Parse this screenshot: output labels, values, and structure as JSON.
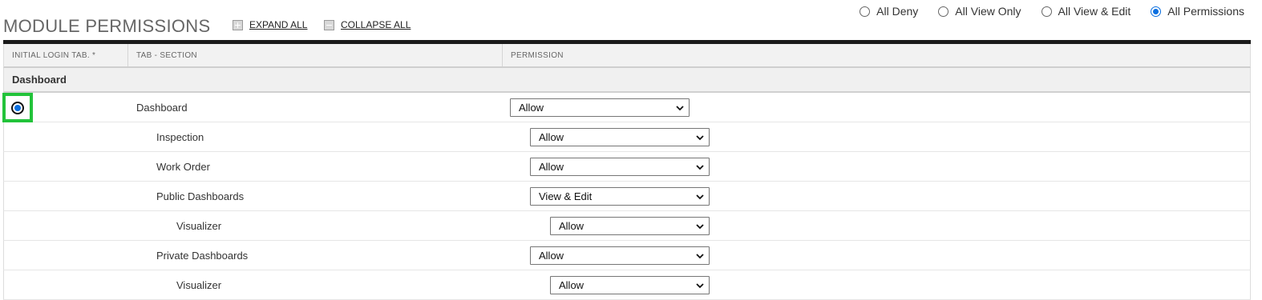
{
  "header": {
    "title": "MODULE PERMISSIONS",
    "expand_all": "EXPAND ALL",
    "collapse_all": "COLLAPSE ALL"
  },
  "bulk_options": [
    {
      "label": "All Deny",
      "checked": false
    },
    {
      "label": "All View Only",
      "checked": false
    },
    {
      "label": "All View & Edit",
      "checked": false
    },
    {
      "label": "All Permissions",
      "checked": true
    }
  ],
  "table": {
    "columns": [
      "INITIAL LOGIN TAB. *",
      "TAB - SECTION",
      "PERMISSION"
    ],
    "group": "Dashboard",
    "rows": [
      {
        "label": "Dashboard",
        "level": 0,
        "permission": "Allow",
        "initial_login": true
      },
      {
        "label": "Inspection",
        "level": 1,
        "permission": "Allow"
      },
      {
        "label": "Work Order",
        "level": 1,
        "permission": "Allow"
      },
      {
        "label": "Public Dashboards",
        "level": 1,
        "permission": "View & Edit"
      },
      {
        "label": "Visualizer",
        "level": 2,
        "permission": "Allow"
      },
      {
        "label": "Private Dashboards",
        "level": 1,
        "permission": "Allow"
      },
      {
        "label": "Visualizer",
        "level": 2,
        "permission": "Allow"
      }
    ]
  },
  "colors": {
    "accent": "#0a6fe0",
    "highlight": "#22c33a",
    "header_bar": "#1b1b1b"
  }
}
